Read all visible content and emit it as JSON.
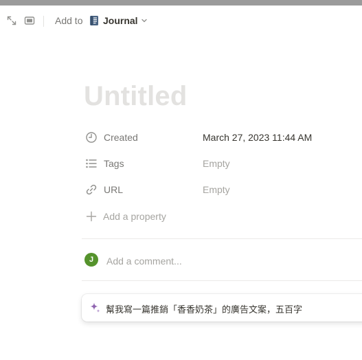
{
  "toolbar": {
    "expand_icon": "expand-arrows-icon",
    "peek_icon": "side-peek-icon",
    "add_to_label": "Add to",
    "database_name": "Journal",
    "database_icon": "notebook-icon",
    "chevron_icon": "chevron-down-icon"
  },
  "page": {
    "title_placeholder": "Untitled"
  },
  "properties": [
    {
      "name": "Created",
      "value": "March 27, 2023 11:44 AM",
      "icon": "clock-icon"
    },
    {
      "name": "Tags",
      "value": "Empty",
      "icon": "list-icon"
    },
    {
      "name": "URL",
      "value": "Empty",
      "icon": "link-icon"
    }
  ],
  "add_property": {
    "label": "Add a property",
    "icon": "plus-icon"
  },
  "comment": {
    "avatar_initial": "J",
    "avatar_color": "#55932c",
    "placeholder": "Add a comment..."
  },
  "ai": {
    "icon": "sparkle-icon",
    "prompt": "幫我寫一篇推銷「香香奶茶」的廣告文案，五百字",
    "accent": "#9065b0"
  },
  "colors": {
    "top_strip": "#9b9b9b",
    "text": "#37352f",
    "muted": "#787774",
    "placeholder": "#a5a4a0"
  }
}
